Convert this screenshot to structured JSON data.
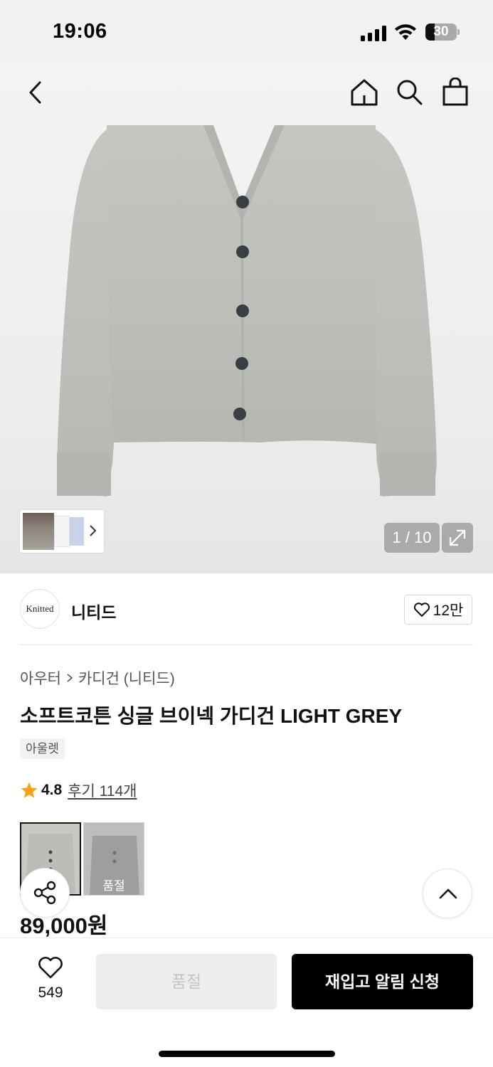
{
  "status_bar": {
    "time": "19:06",
    "battery": "30",
    "battery_level": 0.3
  },
  "nav": {
    "icons": [
      "back-icon",
      "home-icon",
      "search-icon",
      "shopping-bag-icon"
    ]
  },
  "gallery": {
    "counter": "1 / 10",
    "current_index": 1,
    "total": 10,
    "icons": [
      "chevron-right-icon",
      "expand-icon"
    ]
  },
  "brand": {
    "logo_text": "Knitted",
    "name": "니티드",
    "likes": "12만"
  },
  "product": {
    "breadcrumb": [
      "아우터",
      "카디건 (니티드)"
    ],
    "title": "소프트코튼 싱글 브이넥 가디건 LIGHT GREY",
    "tag": "아울렛",
    "rating": "4.8",
    "reviews": "후기 114개",
    "variants": [
      {
        "color_hex": "#c9c9c6",
        "selected": true,
        "label": ""
      },
      {
        "color_hex": "#8e8e8e",
        "selected": false,
        "label": "품절"
      }
    ],
    "price": "89,000원"
  },
  "bottom_bar": {
    "wishlist_count": "549",
    "soldout_label": "품절",
    "restock_label": "재입고 알림 신청"
  }
}
